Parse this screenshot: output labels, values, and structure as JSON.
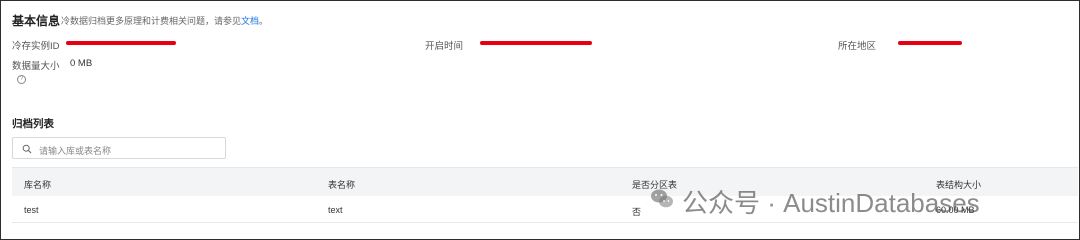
{
  "basic_info": {
    "title": "基本信息",
    "hint_prefix": "冷数据归档更多原理和计费相关问题，请参见",
    "hint_link": "文档",
    "hint_suffix": "。",
    "fields": {
      "instance_id_label": "冷存实例ID",
      "open_time_label": "开启时间",
      "region_label": "所在地区",
      "data_size_label": "数据量大小",
      "data_size_value": "0 MB"
    },
    "redaction_color": "#e60012"
  },
  "archive": {
    "title": "归档列表",
    "search_placeholder": "请输入库或表名称",
    "columns": [
      "库名称",
      "表名称",
      "是否分区表",
      "表结构大小"
    ],
    "rows": [
      {
        "db": "test",
        "table": "text",
        "partitioned": "否",
        "size": "60.00 MB"
      }
    ]
  },
  "watermark": {
    "text": "公众号 · AustinDatabases"
  }
}
